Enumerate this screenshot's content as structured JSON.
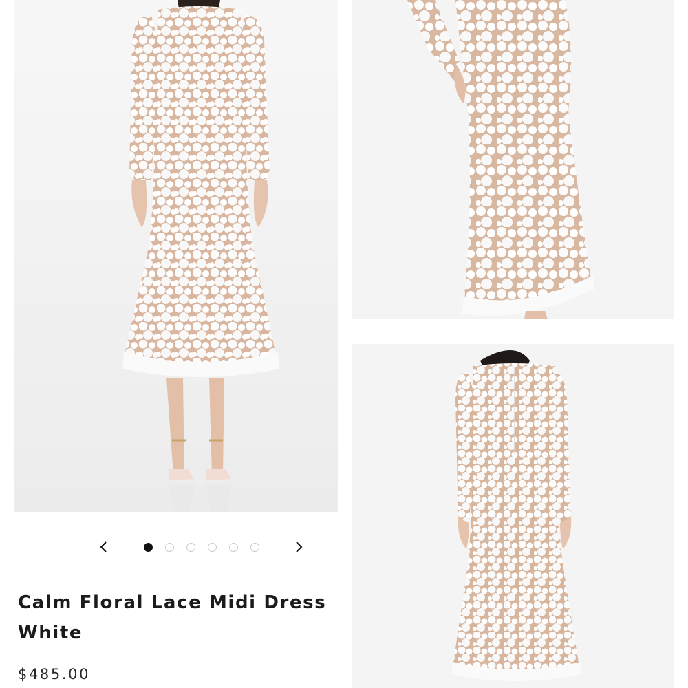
{
  "product": {
    "title_line1": "Calm Floral Lace Midi Dress",
    "title_line2": "White",
    "price": "$485.00"
  },
  "carousel": {
    "prev_icon": "chevron-left-icon",
    "next_icon": "chevron-right-icon",
    "dot_count": 6,
    "active_index": 0
  },
  "images": {
    "main": "model front view wearing white floral lace midi dress",
    "detail_top": "close-up side view of dress skirt",
    "detail_bottom": "model back view of dress"
  },
  "colors": {
    "dress": "#ffffff",
    "lining": "#d9b8a2",
    "background": "#f5f5f5",
    "text": "#1b1b1b"
  }
}
